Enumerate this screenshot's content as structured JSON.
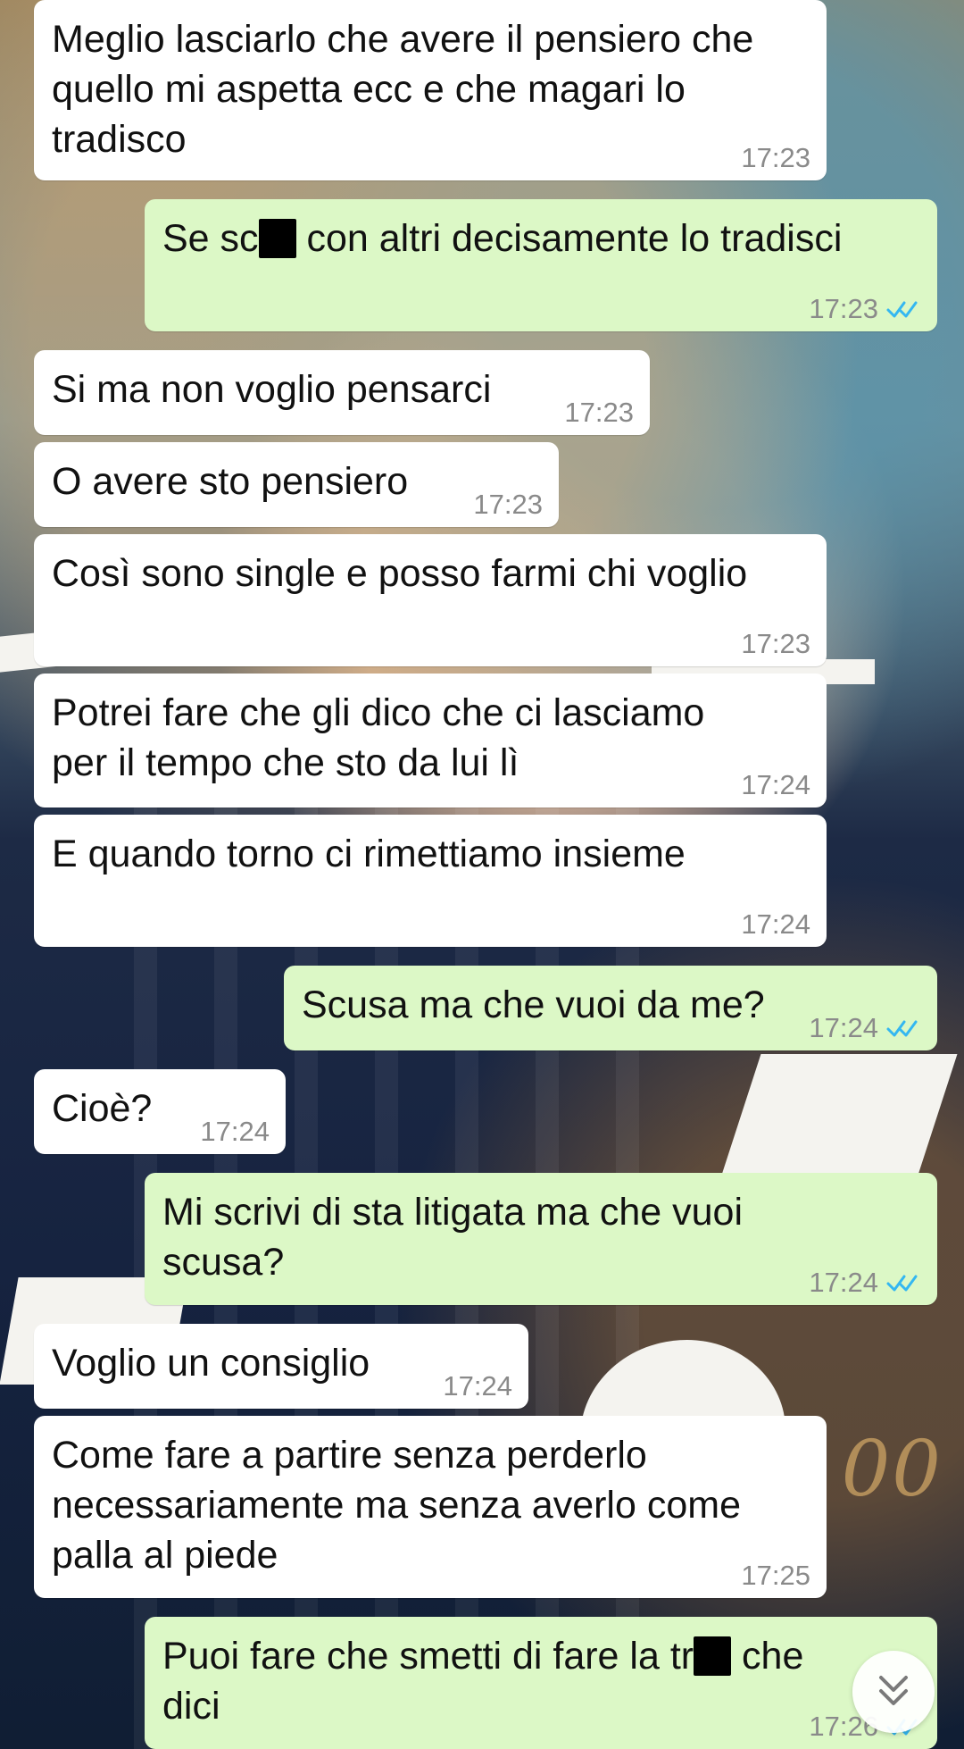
{
  "messages": [
    {
      "text": "Meglio lasciarlo che avere il pensiero che\nquello mi aspetta ecc e che magari lo\ntradisco",
      "time": "17:23"
    },
    {
      "pre": "Se sc",
      "post": " con altri decisamente lo tradisci",
      "time": "17:23",
      "ticks": "read-double-check-icon"
    },
    {
      "text": "Si ma non voglio pensarci",
      "time": "17:23"
    },
    {
      "text": "O avere sto pensiero",
      "time": "17:23"
    },
    {
      "text": "Così sono single e posso farmi chi voglio",
      "time": "17:23"
    },
    {
      "text": "Potrei fare che gli dico che ci lasciamo\nper il tempo che sto da lui lì",
      "time": "17:24"
    },
    {
      "text": "E quando torno ci rimettiamo insieme",
      "time": "17:24"
    },
    {
      "text": "Scusa ma che vuoi da me?",
      "time": "17:24",
      "ticks": "read-double-check-icon"
    },
    {
      "text": "Cioè?",
      "time": "17:24"
    },
    {
      "text": "Mi scrivi di sta litigata ma che vuoi\nscusa?",
      "time": "17:24",
      "ticks": "read-double-check-icon"
    },
    {
      "text": "Voglio un consiglio",
      "time": "17:24"
    },
    {
      "text": "Come fare a partire senza perderlo\nnecessariamente ma senza averlo come\npalla al piede",
      "time": "17:25"
    },
    {
      "pre": "Puoi fare che smetti di fare la tr",
      "post": " che\ndici",
      "time": "17:26",
      "ticks": "read-double-check-icon"
    }
  ],
  "wallpaper": {
    "mark": "00"
  },
  "colors": {
    "incoming_bubble": "#ffffff",
    "outgoing_bubble": "#dcf8c6",
    "read_ticks": "#34b7f1",
    "timestamp": "#8a8a8a"
  },
  "scroll_button": {
    "icon": "double-chevron-down-icon"
  }
}
